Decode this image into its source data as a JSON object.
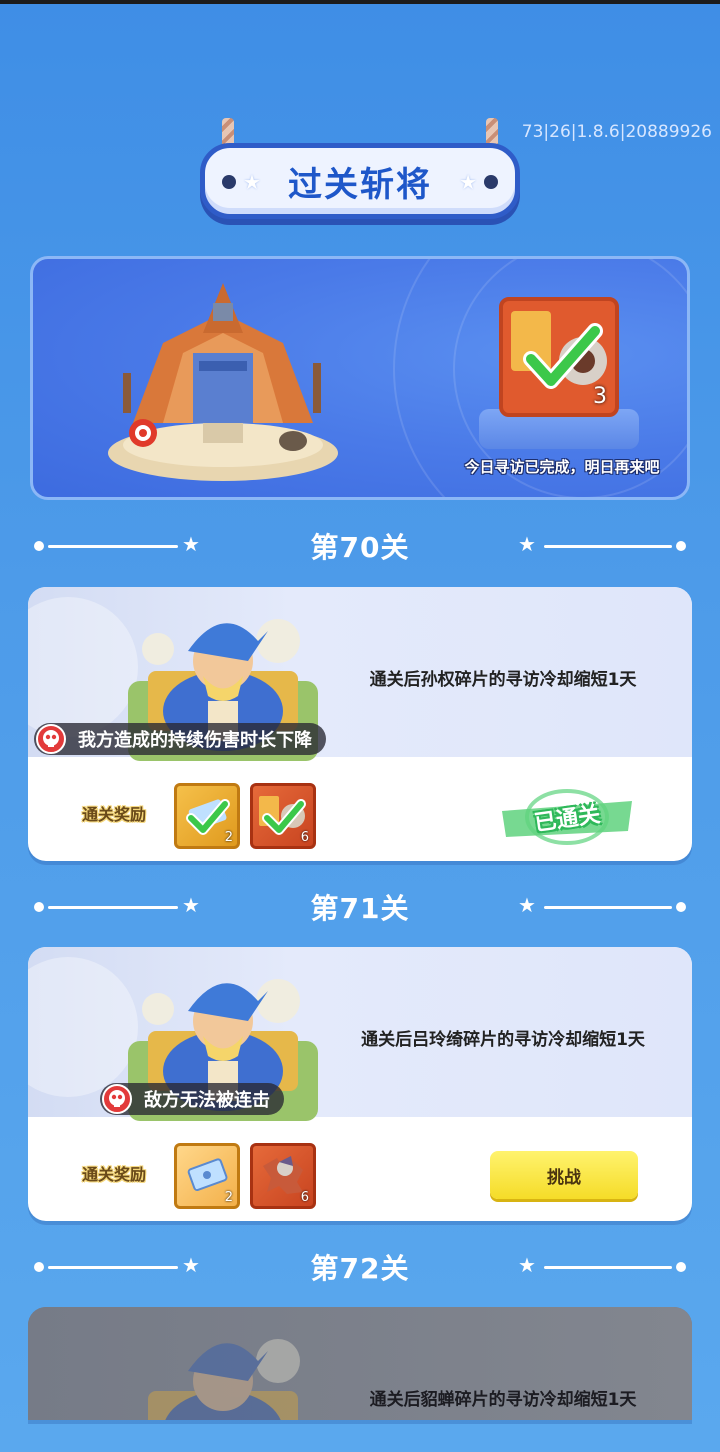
{
  "header": {
    "title": "过关斩将",
    "version": "73|26|1.8.6|20889926"
  },
  "banner": {
    "reward_count": "3",
    "status": "今日寻访已完成，明日再来吧"
  },
  "levels": [
    {
      "level_label": "第70关",
      "description": "通关后孙权碎片的寻访冷却缩短1天",
      "debuff": "我方造成的持续伤害时长下降",
      "reward_label": "通关奖励",
      "rewards": [
        {
          "icon": "ticket-icon",
          "count": "2",
          "claimed": true
        },
        {
          "icon": "hero-fragment-icon",
          "count": "6",
          "claimed": true
        }
      ],
      "state_label": "已通关"
    },
    {
      "level_label": "第71关",
      "description": "通关后吕玲绮碎片的寻访冷却缩短1天",
      "debuff": "敌方无法被连击",
      "reward_label": "通关奖励",
      "rewards": [
        {
          "icon": "ticket-icon",
          "count": "2",
          "claimed": false
        },
        {
          "icon": "hero-fragment-icon",
          "count": "6",
          "claimed": false
        }
      ],
      "state_label": "挑战"
    },
    {
      "level_label": "第72关",
      "description": "通关后貂蝉碎片的寻访冷却缩短1天",
      "locked": true
    }
  ],
  "colors": {
    "background": "#4d9be9",
    "sign_border": "#2f5cc8",
    "challenge_button": "#f5dc28",
    "passed_green": "#2fb85a"
  }
}
